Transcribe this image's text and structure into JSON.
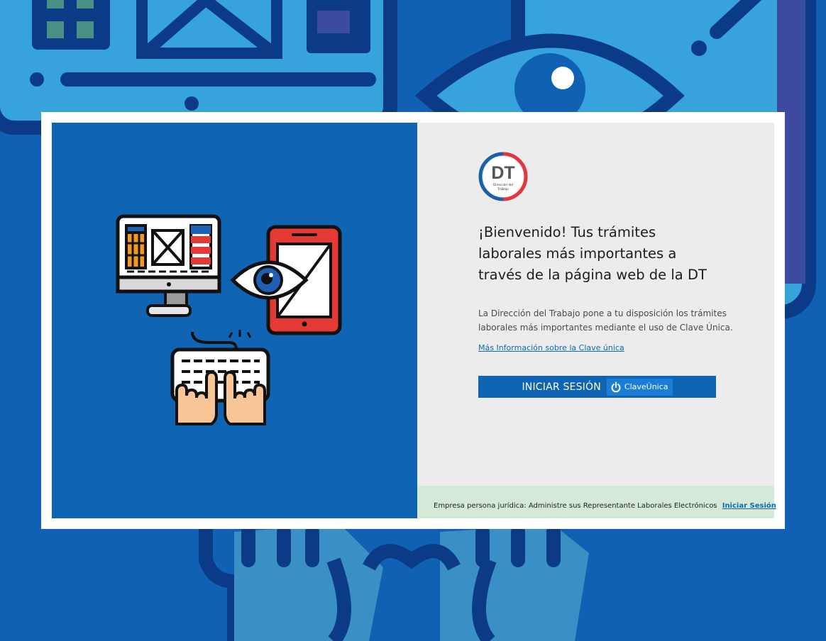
{
  "colors": {
    "background": "#1061b3",
    "panel_blue": "#1064b4",
    "panel_gray": "#ececed",
    "footer_green": "#d5e9d9",
    "link": "#0d6ab8",
    "logo_blue": "#1a5fa8",
    "logo_red": "#e0363f"
  },
  "logo": {
    "initials": "DT",
    "line1": "Dirección del",
    "line2": "Trabajo"
  },
  "welcome": {
    "line1": "¡Bienvenido! Tus trámites",
    "line2": "laborales más importantes a",
    "line3": "través de la página web de la DT"
  },
  "description": {
    "line1": "La Dirección del Trabajo pone a tu disposición los trámites",
    "line2": "laborales más importantes mediante el uso de Clave Única."
  },
  "more_info_link": "Más Información sobre la Clave única",
  "login_button": {
    "label": "INICIAR SESIÓN",
    "badge": "ClaveÚnica",
    "badge_icon": "power-icon"
  },
  "footer": {
    "text": "Empresa persona jurídica: Administre sus Representante Laborales Electrónicos",
    "link": "Iniciar Sesión"
  },
  "illustration": {
    "icons": [
      "monitor-icon",
      "tablet-icon",
      "eye-icon",
      "keyboard-icon",
      "hands-icon"
    ]
  }
}
